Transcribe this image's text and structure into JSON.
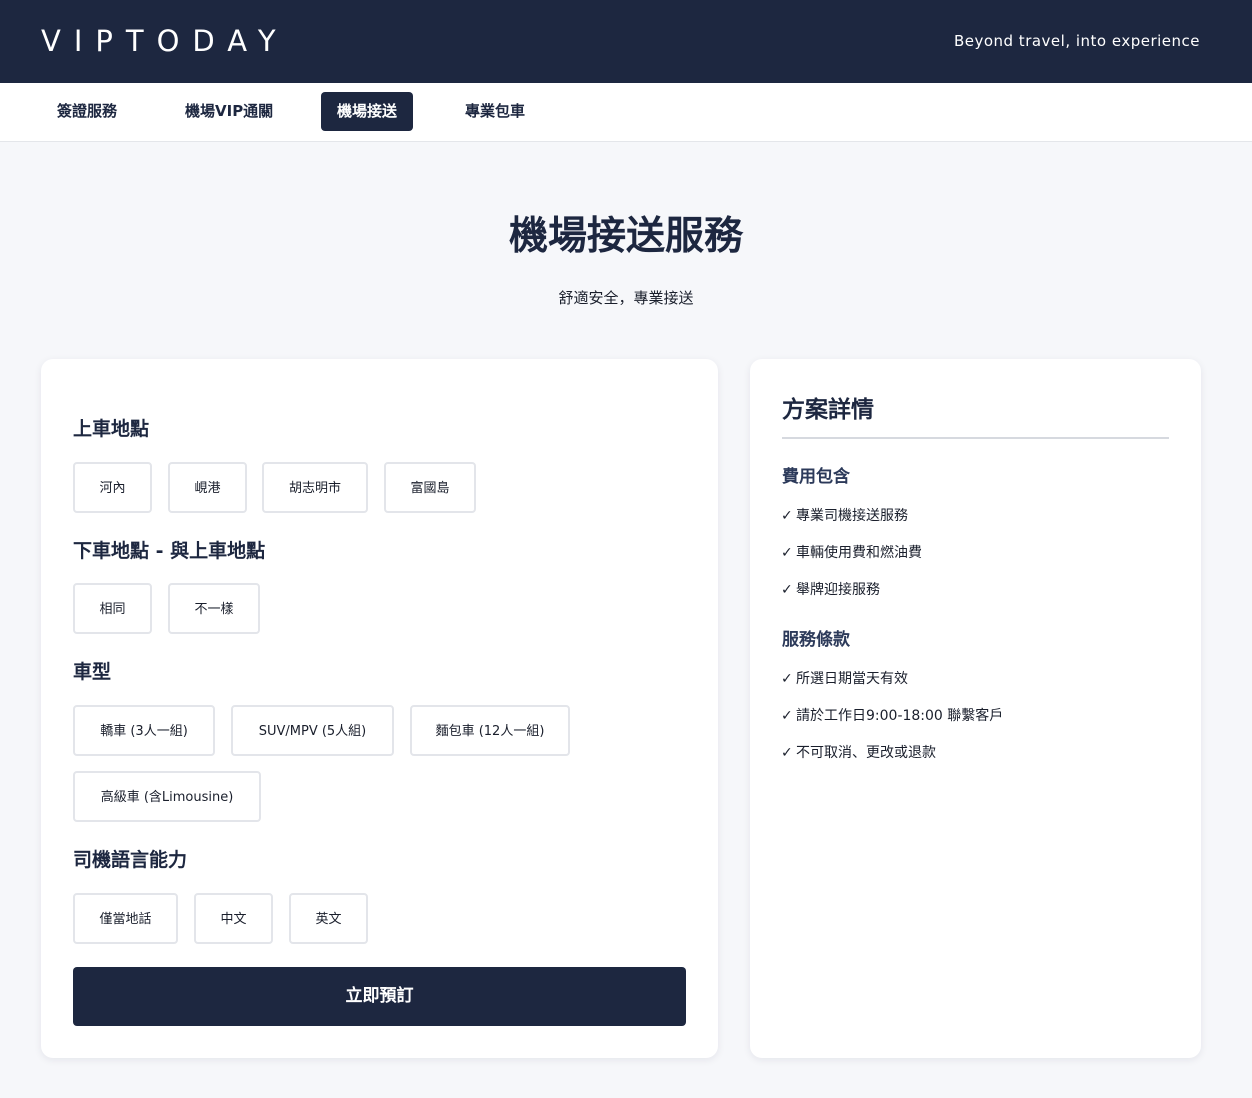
{
  "header": {
    "logo": "VIPTODAY",
    "tagline": "Beyond travel, into experience"
  },
  "nav": {
    "tabs": [
      {
        "label": "簽證服務"
      },
      {
        "label": "機場VIP通關"
      },
      {
        "label": "機場接送",
        "active": true
      },
      {
        "label": "專業包車"
      }
    ]
  },
  "hero": {
    "title": "機場接送服務",
    "subtitle": "舒適安全，專業接送"
  },
  "form": {
    "pickup": {
      "title": "上車地點",
      "options": [
        "河內",
        "峴港",
        "胡志明市",
        "富國島"
      ]
    },
    "dropoff": {
      "title": "下車地點 - 與上車地點",
      "options": [
        "相同",
        "不一樣"
      ]
    },
    "vehicle": {
      "title": "車型",
      "options": [
        "轎車 (3人一組)",
        "SUV/MPV (5人組)",
        "麵包車 (12人一組)",
        "高級車 (含Limousine)"
      ]
    },
    "language": {
      "title": "司機語言能力",
      "options": [
        "僅當地話",
        "中文",
        "英文"
      ]
    },
    "submit_label": "立即預訂"
  },
  "details": {
    "title": "方案詳情",
    "check_glyph": "✓",
    "included": {
      "title": "費用包含",
      "items": [
        "專業司機接送服務",
        "車輛使用費和燃油費",
        "舉牌迎接服務"
      ]
    },
    "terms": {
      "title": "服務條款",
      "items": [
        "所選日期當天有效",
        "請於工作日9:00-18:00 聯繫客戶",
        "不可取消、更改或退款"
      ]
    }
  },
  "colors": {
    "brand_navy": "#1d2740",
    "page_bg": "#f6f7fa",
    "option_border": "#e3e5ea"
  }
}
